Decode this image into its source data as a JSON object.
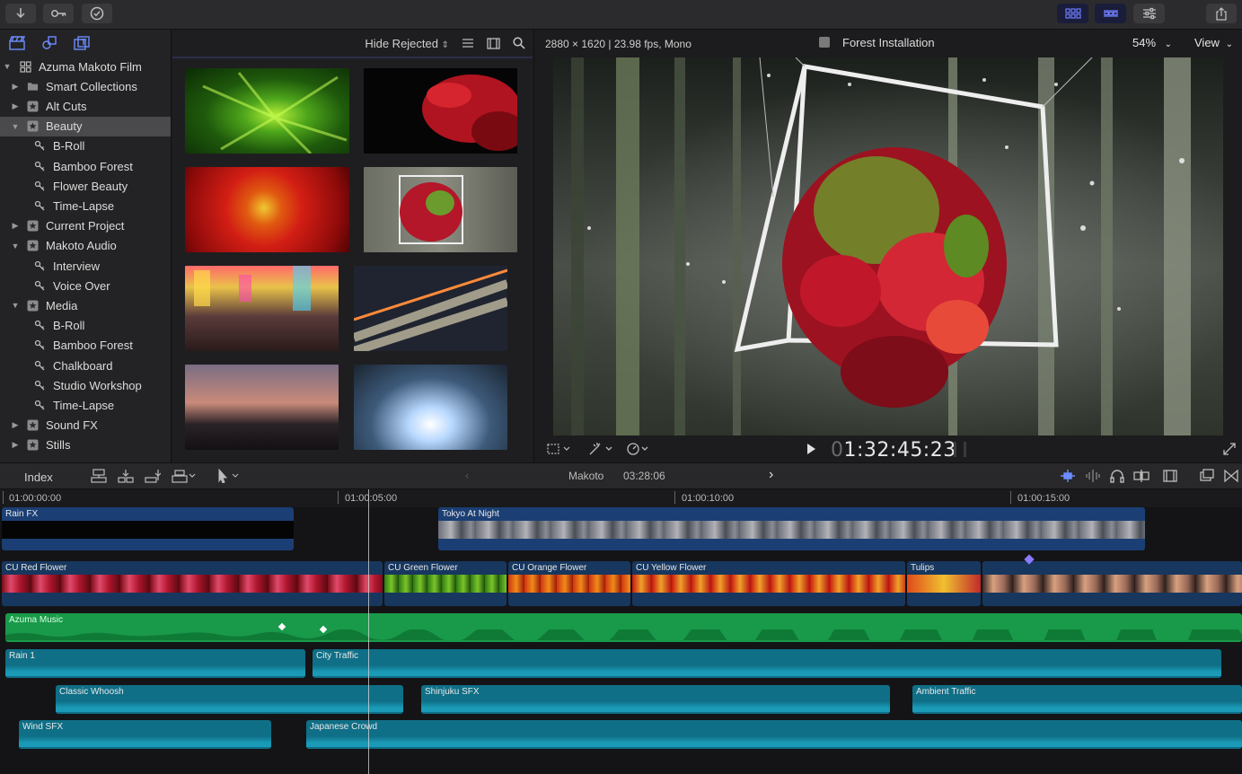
{
  "browser": {
    "filter": "Hide Rejected",
    "library": "Azuma Makoto Film",
    "items": [
      {
        "label": "Azuma Makoto Film",
        "icon": "library-icon",
        "level": 0,
        "expanded": true
      },
      {
        "label": "Smart Collections",
        "icon": "folder-icon",
        "level": 1,
        "expanded": false
      },
      {
        "label": "Alt Cuts",
        "icon": "event-icon",
        "level": 1,
        "expanded": false
      },
      {
        "label": "Beauty",
        "icon": "event-icon",
        "level": 1,
        "expanded": true,
        "selected": true
      },
      {
        "label": "B-Roll",
        "icon": "keyword-icon",
        "level": 2
      },
      {
        "label": "Bamboo Forest",
        "icon": "keyword-icon",
        "level": 2
      },
      {
        "label": "Flower Beauty",
        "icon": "keyword-icon",
        "level": 2
      },
      {
        "label": "Time-Lapse",
        "icon": "keyword-icon",
        "level": 2
      },
      {
        "label": "Current Project",
        "icon": "event-icon",
        "level": 1,
        "expanded": false
      },
      {
        "label": "Makoto Audio",
        "icon": "event-icon",
        "level": 1,
        "expanded": true
      },
      {
        "label": "Interview",
        "icon": "keyword-icon",
        "level": 2
      },
      {
        "label": "Voice Over",
        "icon": "keyword-icon",
        "level": 2
      },
      {
        "label": "Media",
        "icon": "event-icon",
        "level": 1,
        "expanded": true
      },
      {
        "label": "B-Roll",
        "icon": "keyword-icon",
        "level": 2
      },
      {
        "label": "Bamboo Forest",
        "icon": "keyword-icon",
        "level": 2
      },
      {
        "label": "Chalkboard",
        "icon": "keyword-icon",
        "level": 2
      },
      {
        "label": "Studio Workshop",
        "icon": "keyword-icon",
        "level": 2
      },
      {
        "label": "Time-Lapse",
        "icon": "keyword-icon",
        "level": 2
      },
      {
        "label": "Sound FX",
        "icon": "event-icon",
        "level": 1,
        "expanded": false
      },
      {
        "label": "Stills",
        "icon": "event-icon",
        "level": 1,
        "expanded": false
      }
    ]
  },
  "viewer": {
    "format": "2880 × 1620 | 23.98 fps, Mono",
    "clip_name": "Forest Installation",
    "zoom": "54%",
    "view_menu": "View",
    "timecode_dim": "0",
    "timecode": "1:32:45:23"
  },
  "timeline": {
    "index_label": "Index",
    "project_name": "Makoto",
    "duration": "03:28:06",
    "ruler": [
      "01:00:00:00",
      "01:00:05:00",
      "01:00:10:00",
      "01:00:15:00"
    ],
    "clips": {
      "rain_fx": "Rain FX",
      "tokyo": "Tokyo At Night",
      "cu_red": "CU Red Flower",
      "cu_green": "CU Green Flower",
      "cu_orange": "CU Orange Flower",
      "cu_yellow": "CU Yellow Flower",
      "tulips": "Tulips",
      "music": "Azuma Music",
      "rain1": "Rain 1",
      "city": "City Traffic",
      "whoosh": "Classic Whoosh",
      "shinjuku": "Shinjuku SFX",
      "ambient": "Ambient Traffic",
      "wind": "Wind SFX",
      "crowd": "Japanese Crowd"
    }
  },
  "colors": {
    "accent": "#6d8cff",
    "video_clip": "#1b3f74",
    "music_clip": "#199a4a",
    "sfx_clip": "#0f6f87"
  }
}
